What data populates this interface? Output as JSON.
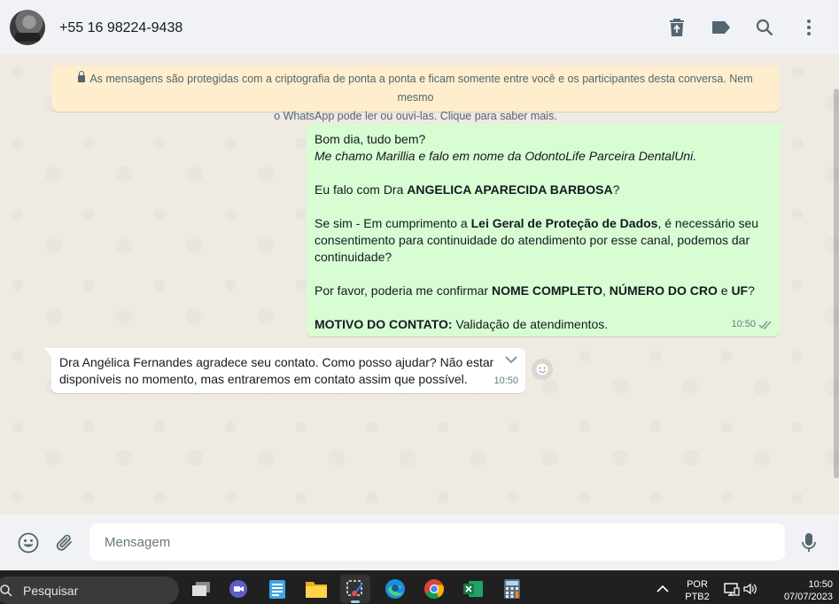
{
  "header": {
    "contact_name": "+55 16 98224-9438",
    "icons": [
      "delete-icon",
      "label-icon",
      "search-icon",
      "menu-dots-icon"
    ]
  },
  "encryption_notice": {
    "line1": "As mensagens são protegidas com a criptografia de ponta a ponta e ficam somente entre você e os participantes desta conversa. Nem mesmo",
    "line2": "o WhatsApp pode ler ou ouvi-las. Clique para saber mais."
  },
  "outgoing_message": {
    "greeting": "Bom dia, tudo bem?",
    "intro": "Me chamo Marillia e falo em nome da OdontoLife Parceira DentalUni.",
    "ask_pre": "Eu falo com Dra ",
    "ask_name": "ANGELICA APARECIDA BARBOSA",
    "ask_post": "?",
    "consent_pre": "Se sim - Em cumprimento a ",
    "consent_law": "Lei Geral de Proteção de Dados",
    "consent_post": ", é necessário seu consentimento para continuidade do atendimento por esse canal, podemos dar continuidade?",
    "confirm_pre": "Por favor, poderia me confirmar ",
    "confirm_name": "NOME COMPLETO",
    "confirm_sep1": ", ",
    "confirm_cro": "NÚMERO DO CRO",
    "confirm_sep2": " e ",
    "confirm_uf": "UF",
    "confirm_post": "?",
    "motive_label": "MOTIVO DO CONTATO:",
    "motive_text": " Validação de atendimentos.",
    "time": "10:50",
    "status": "read"
  },
  "incoming_message": {
    "line1": "Dra Angélica Fernandes agradece seu contato. Como posso ajudar? Não estamos",
    "line2": "disponíveis no momento, mas entraremos em contato assim que possível.",
    "time": "10:50"
  },
  "composer": {
    "placeholder": "Mensagem"
  },
  "taskbar": {
    "search_label": "Pesquisar",
    "language": "POR",
    "layout": "PTB2",
    "time": "10:50",
    "date": "07/07/2023"
  },
  "colors": {
    "outgoing_bubble": "#d9fdd3",
    "incoming_bubble": "#ffffff",
    "notice_bg": "#ffeecd",
    "chat_bg": "#efeae2",
    "header_bg": "#f0f2f5",
    "read_ticks": "#53bdeb"
  }
}
